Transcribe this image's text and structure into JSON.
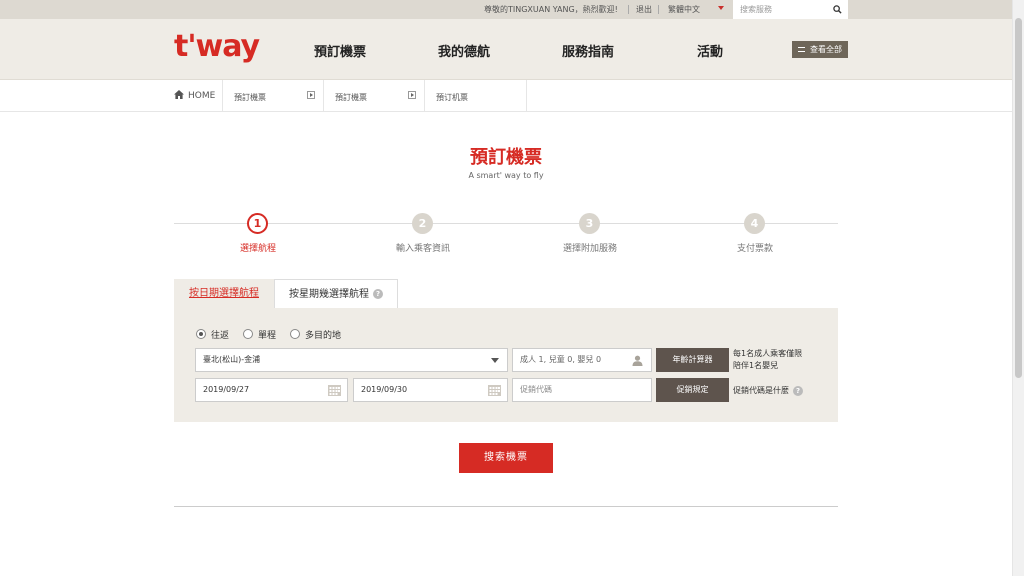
{
  "topbar": {
    "greeting": "尊敬的TINGXUAN YANG，熱烈歡迎!",
    "logout": "退出",
    "language": "繁體中文",
    "search_placeholder": "搜索服務"
  },
  "header": {
    "logo": "t'way",
    "nav": [
      "預訂機票",
      "我的德航",
      "服務指南",
      "活動"
    ],
    "view_all": "查看全部"
  },
  "breadcrumb": {
    "home": "HOME",
    "items": [
      "預訂機票",
      "預訂機票",
      "預订机票"
    ]
  },
  "page": {
    "title": "預訂機票",
    "subtitle": "A smart' way to fly"
  },
  "steps": [
    {
      "num": "1",
      "label": "選擇航程",
      "active": true
    },
    {
      "num": "2",
      "label": "輸入乘客資訊",
      "active": false
    },
    {
      "num": "3",
      "label": "選擇附加服務",
      "active": false
    },
    {
      "num": "4",
      "label": "支付票款",
      "active": false
    }
  ],
  "tabs": {
    "by_date": "按日期選擇航程",
    "by_week": "按星期幾選擇航程",
    "help": "?"
  },
  "form": {
    "trip_types": [
      "往返",
      "單程",
      "多目的地"
    ],
    "selected_trip": "往返",
    "route": "臺北(松山)-金浦",
    "passengers": "成人 1, 兒童 0, 嬰兒 0",
    "age_calc": "年齡計算器",
    "note_line1": "每1名成人乘客僅限",
    "note_line2": "陪伴1名嬰兒",
    "depart_date": "2019/09/27",
    "return_date": "2019/09/30",
    "promo_placeholder": "促銷代碼",
    "promo_rules": "促銷規定",
    "promo_question": "促銷代碼是什麼",
    "help": "?"
  },
  "search_button": "搜索機票",
  "colors": {
    "brand_red": "#d62b24",
    "dark_button": "#5e544d",
    "panel_bg": "#efece6"
  }
}
